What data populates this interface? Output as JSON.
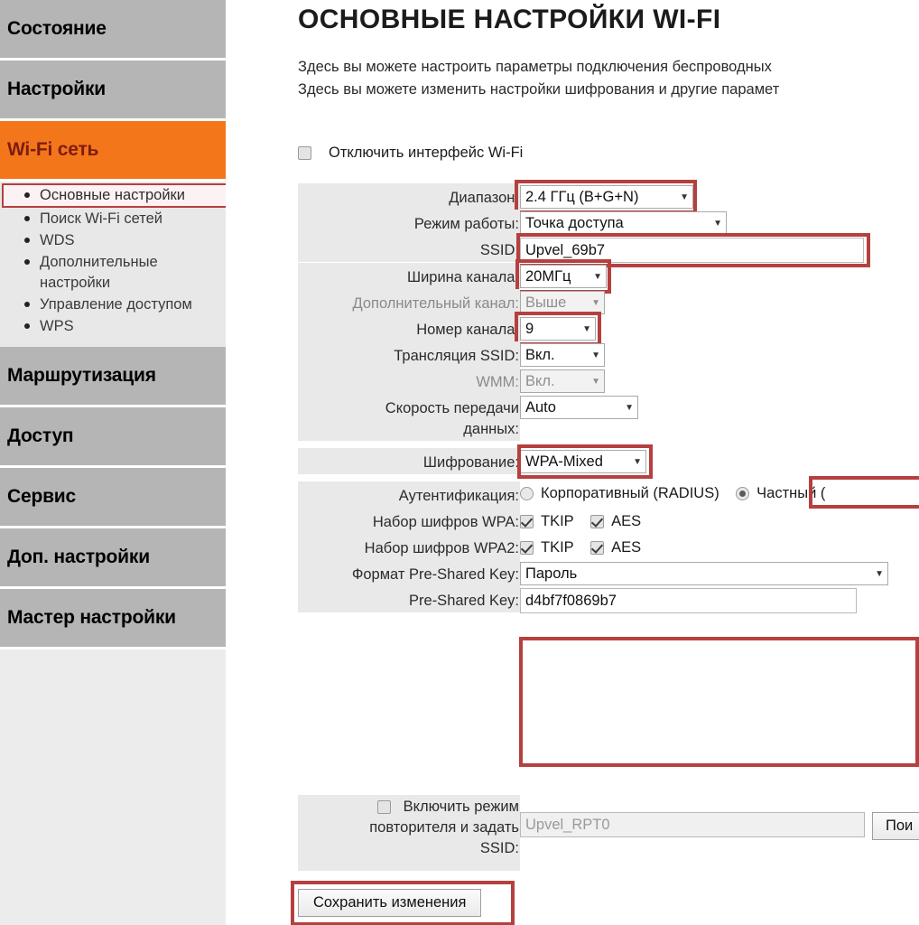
{
  "sidebar": {
    "sections": [
      {
        "label": "Состояние",
        "active": false
      },
      {
        "label": "Настройки",
        "active": false
      },
      {
        "label": "Wi-Fi сеть",
        "active": true
      }
    ],
    "subitems": [
      {
        "label": "Основные настройки",
        "highlighted": true
      },
      {
        "label": "Поиск Wi-Fi сетей",
        "highlighted": false
      },
      {
        "label": "WDS",
        "highlighted": false
      },
      {
        "label": "Дополнительные настройки",
        "highlighted": false
      },
      {
        "label": "Управление доступом",
        "highlighted": false
      },
      {
        "label": "WPS",
        "highlighted": false
      }
    ],
    "sections_bottom": [
      {
        "label": "Маршрутизация"
      },
      {
        "label": "Доступ"
      },
      {
        "label": "Сервис"
      },
      {
        "label": "Доп. настройки"
      },
      {
        "label": "Мастер настройки"
      }
    ]
  },
  "main": {
    "title": "ОСНОВНЫЕ НАСТРОЙКИ WI-FI",
    "description_line1": "Здесь вы можете настроить параметры подключения беспроводных",
    "description_line2": "Здесь вы можете изменить настройки шифрования и другие парамет",
    "disable_wifi_label": "Отключить интерфейс Wi-Fi",
    "disable_wifi_checked": false,
    "fields": {
      "band_label": "Диапазон:",
      "band_value": "2.4 ГГц (B+G+N)",
      "mode_label": "Режим работы:",
      "mode_value": "Точка доступа",
      "ssid_label": "SSID:",
      "ssid_value": "Upvel_69b7",
      "chan_width_label": "Ширина канала:",
      "chan_width_value": "20МГц",
      "ext_chan_label": "Дополнительный канал:",
      "ext_chan_value": "Выше",
      "chan_num_label": "Номер канала:",
      "chan_num_value": "9",
      "ssid_bcast_label": "Трансляция SSID:",
      "ssid_bcast_value": "Вкл.",
      "wmm_label": "WMM:",
      "wmm_value": "Вкл.",
      "rate_label_line1": "Скорость передачи",
      "rate_label_line2": "данных:",
      "rate_value": "Auto",
      "encryption_label": "Шифрование:",
      "encryption_value": "WPA-Mixed",
      "auth_label": "Аутентификация:",
      "auth_enterprise": "Корпоративный (RADIUS)",
      "auth_enterprise_selected": false,
      "auth_personal": "Частный (",
      "auth_personal_selected": true,
      "wpa_cipher_label": "Набор шифров WPA:",
      "wpa2_cipher_label": "Набор шифров WPA2:",
      "tkip_label": "TKIP",
      "aes_label": "AES",
      "wpa_tkip_checked": true,
      "wpa_aes_checked": true,
      "wpa2_tkip_checked": true,
      "wpa2_aes_checked": true,
      "psk_format_label": "Формат Pre-Shared Key:",
      "psk_format_value": "Пароль",
      "psk_label": "Pre-Shared Key:",
      "psk_value": "d4bf7f0869b7"
    },
    "repeater": {
      "label_line1": "Включить режим",
      "label_line2": "повторителя и задать",
      "label_line3": "SSID:",
      "checked": false,
      "ssid_value": "Upvel_RPT0",
      "search_button": "Пои"
    },
    "save_button": "Сохранить изменения"
  },
  "colors": {
    "accent_orange": "#f4761b",
    "sidebar_gray": "#b5b5b5",
    "annotation_red": "#b5403f",
    "panel_gray": "#e9e9e9"
  },
  "icons": {
    "dropdown_arrow": "▼",
    "bullet": "•"
  }
}
